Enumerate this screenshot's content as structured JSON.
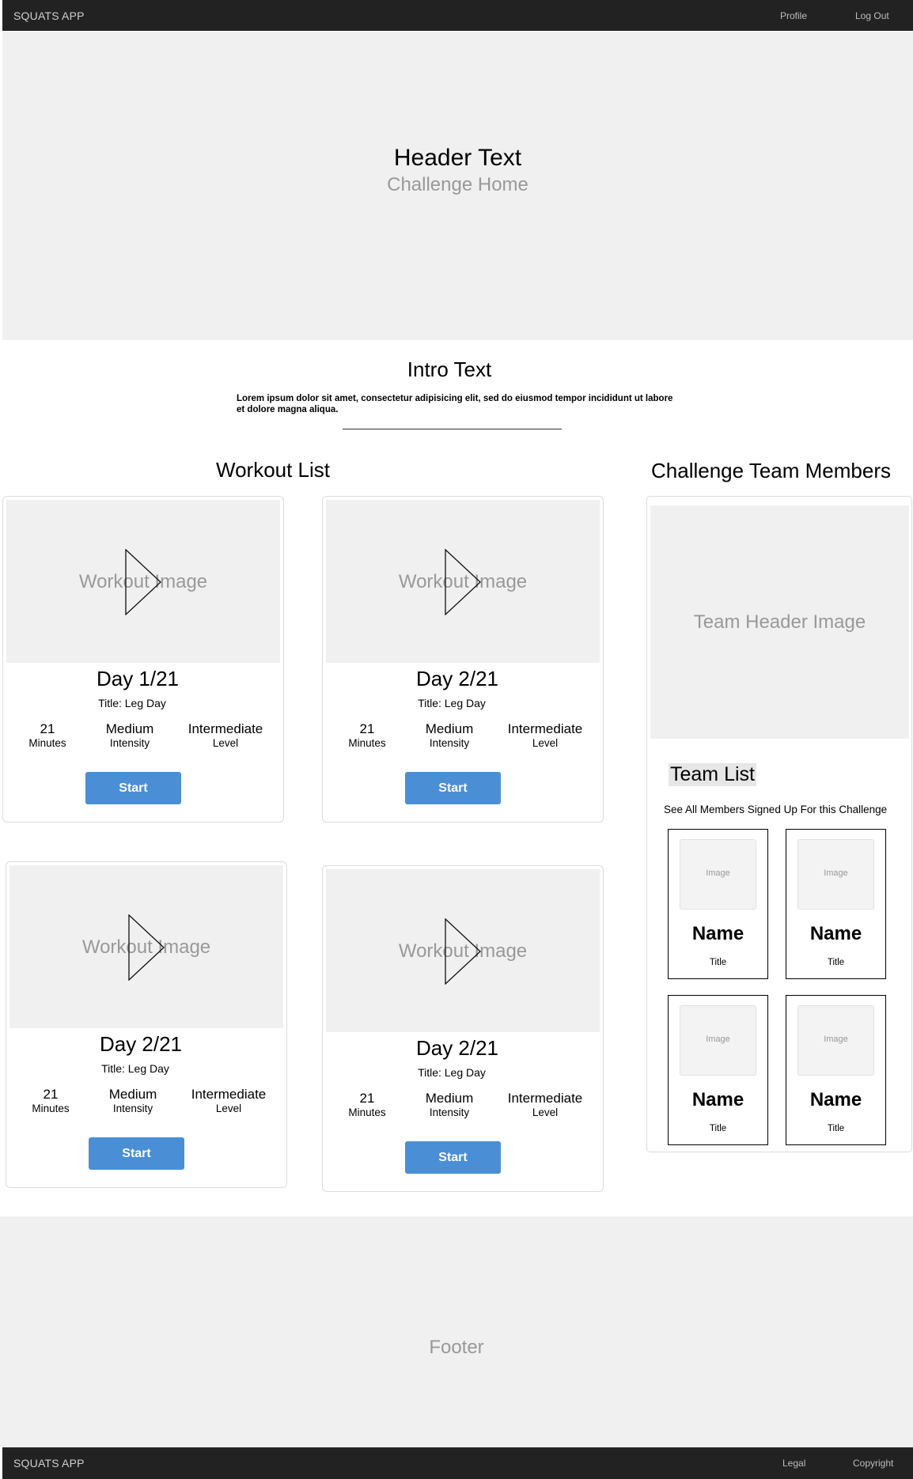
{
  "navbar": {
    "brand": "SQUATS APP",
    "links": [
      "Profile",
      "Log Out"
    ]
  },
  "hero": {
    "title": "Header Text",
    "subtitle": "Challenge Home"
  },
  "intro": {
    "title": "Intro Text",
    "body": "Lorem ipsum dolor sit amet, consectetur adipisicing elit, sed do eiusmod tempor incididunt ut labore et dolore magna aliqua."
  },
  "workout_list": {
    "title": "Workout List",
    "cards": [
      {
        "image_label": "Workout Image",
        "day": "Day 1/21",
        "title": "Title: Leg Day",
        "stats": [
          {
            "value": "21",
            "label": "Minutes"
          },
          {
            "value": "Medium",
            "label": "Intensity"
          },
          {
            "value": "Intermediate",
            "label": "Level"
          }
        ],
        "button": "Start"
      },
      {
        "image_label": "Workout Image",
        "day": "Day 2/21",
        "title": "Title: Leg Day",
        "stats": [
          {
            "value": "21",
            "label": "Minutes"
          },
          {
            "value": "Medium",
            "label": "Intensity"
          },
          {
            "value": "Intermediate",
            "label": "Level"
          }
        ],
        "button": "Start"
      },
      {
        "image_label": "Workout Image",
        "day": "Day 2/21",
        "title": "Title: Leg Day",
        "stats": [
          {
            "value": "21",
            "label": "Minutes"
          },
          {
            "value": "Medium",
            "label": "Intensity"
          },
          {
            "value": "Intermediate",
            "label": "Level"
          }
        ],
        "button": "Start"
      },
      {
        "image_label": "Workout Image",
        "day": "Day 2/21",
        "title": "Title: Leg Day",
        "stats": [
          {
            "value": "21",
            "label": "Minutes"
          },
          {
            "value": "Medium",
            "label": "Intensity"
          },
          {
            "value": "Intermediate",
            "label": "Level"
          }
        ],
        "button": "Start"
      }
    ]
  },
  "team": {
    "title": "Challenge Team Members",
    "header_image_label": "Team Header Image",
    "list_title": "Team List",
    "description": "See All Members Signed Up For this Challenge",
    "members": [
      {
        "image_label": "Image",
        "name": "Name",
        "title": "Title"
      },
      {
        "image_label": "Image",
        "name": "Name",
        "title": "Title"
      },
      {
        "image_label": "Image",
        "name": "Name",
        "title": "Title"
      },
      {
        "image_label": "Image",
        "name": "Name",
        "title": "Title"
      }
    ]
  },
  "footer": {
    "label": "Footer",
    "brand": "SQUATS APP",
    "links": [
      "Legal",
      "Copyright"
    ]
  },
  "colors": {
    "navbar": "#222222",
    "placeholder_bg": "#f0f0f0",
    "button": "#4a8fd6"
  }
}
